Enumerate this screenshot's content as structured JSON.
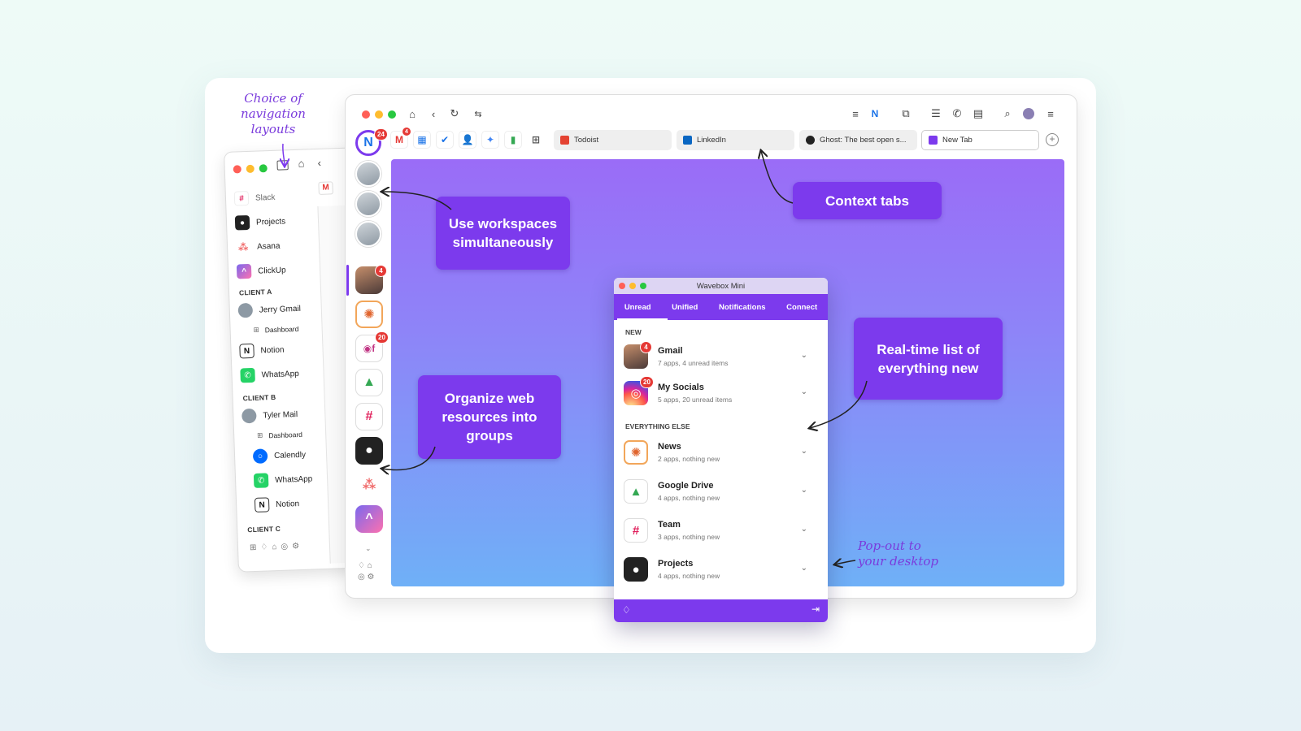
{
  "annotations": {
    "nav_layouts": "Choice of navigation layouts",
    "popout": "Pop-out to your desktop"
  },
  "callouts": {
    "workspaces": "Use workspaces simultaneously",
    "context_tabs": "Context tabs",
    "organize": "Organize web resources into groups",
    "realtime": "Real-time list of everything new"
  },
  "sidebar": {
    "items": [
      {
        "label": "Slack",
        "icon": "slack-icon"
      },
      {
        "label": "Projects",
        "icon": "github-icon"
      },
      {
        "label": "Asana",
        "icon": "asana-icon"
      },
      {
        "label": "ClickUp",
        "icon": "clickup-icon"
      }
    ],
    "client_a": {
      "title": "CLIENT A",
      "items": [
        {
          "label": "Jerry Gmail",
          "icon": "avatar-icon"
        },
        {
          "label": "Dashboard",
          "icon": "grid-icon"
        },
        {
          "label": "Notion",
          "icon": "notion-icon"
        },
        {
          "label": "WhatsApp",
          "icon": "whatsapp-icon"
        }
      ]
    },
    "client_b": {
      "title": "CLIENT B",
      "items": [
        {
          "label": "Tyler Mail",
          "icon": "avatar-icon"
        },
        {
          "label": "Dashboard",
          "icon": "grid-icon"
        },
        {
          "label": "Calendly",
          "icon": "calendly-icon"
        },
        {
          "label": "WhatsApp",
          "icon": "whatsapp-icon"
        },
        {
          "label": "Notion",
          "icon": "notion-icon"
        }
      ]
    },
    "client_c": {
      "title": "CLIENT C"
    }
  },
  "browser": {
    "tabs": [
      {
        "label": "Todoist",
        "color": "#e44332"
      },
      {
        "label": "LinkedIn",
        "color": "#0a66c2"
      },
      {
        "label": "Ghost: The best open s...",
        "color": "#222222"
      },
      {
        "label": "New Tab",
        "color": "#7c3aed"
      }
    ],
    "badges": {
      "wavebox": "24",
      "gmail": "4",
      "personal": "4",
      "socials": "20"
    },
    "colors": {
      "accent": "#7c3aed",
      "badge": "#e53935"
    }
  },
  "mini": {
    "title": "Wavebox Mini",
    "tabs": [
      "Unread",
      "Unified",
      "Notifications",
      "Connect"
    ],
    "sections": {
      "new": "NEW",
      "else": "EVERYTHING ELSE"
    },
    "new_items": [
      {
        "name": "Gmail",
        "sub": "7 apps, 4 unread items",
        "badge": "4",
        "icon": "avatar-icon"
      },
      {
        "name": "My Socials",
        "sub": "5 apps, 20 unread items",
        "badge": "20",
        "icon": "instagram-icon"
      }
    ],
    "else_items": [
      {
        "name": "News",
        "sub": "2 apps, nothing new",
        "icon": "sunburst-icon"
      },
      {
        "name": "Google Drive",
        "sub": "4 apps, nothing new",
        "icon": "drive-icon"
      },
      {
        "name": "Team",
        "sub": "3 apps, nothing new",
        "icon": "slack-icon"
      },
      {
        "name": "Projects",
        "sub": "4 apps, nothing new",
        "icon": "github-icon"
      }
    ]
  }
}
